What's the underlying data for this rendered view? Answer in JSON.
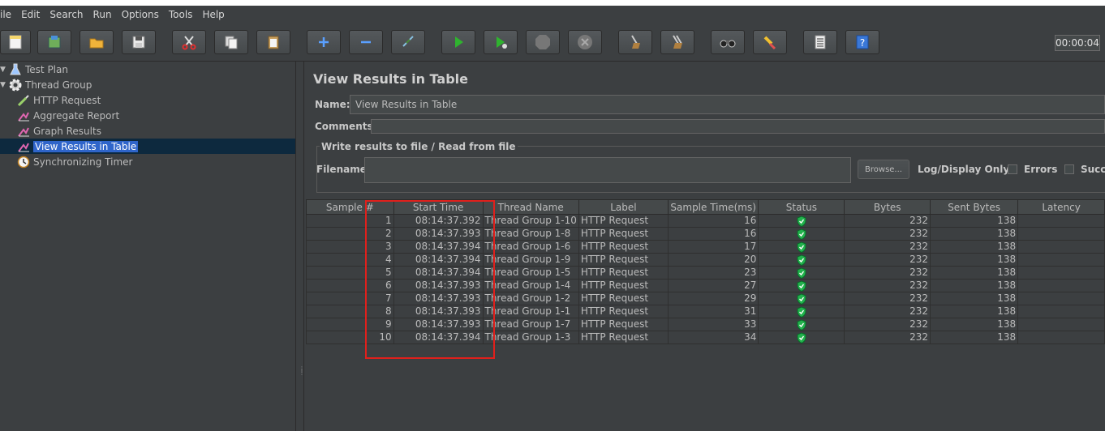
{
  "menu": [
    "ile",
    "Edit",
    "Search",
    "Run",
    "Options",
    "Tools",
    "Help"
  ],
  "toolbar": {
    "buttons": [
      "new-icon",
      "templates-icon",
      "open-icon",
      "save-icon",
      "cut-icon",
      "copy-icon",
      "paste-icon",
      "expand-icon",
      "collapse-icon",
      "toggle-icon",
      "start-icon",
      "start-no-pauses-icon",
      "stop-icon",
      "shutdown-icon",
      "clear-icon",
      "clear-all-icon",
      "search-icon",
      "reset-search-icon",
      "function-helper-icon",
      "help-icon"
    ],
    "timer": "00:00:04"
  },
  "tree": {
    "items": [
      {
        "label": "Test Plan",
        "icon": "test-plan-icon"
      },
      {
        "label": "Thread Group",
        "icon": "gear-icon"
      },
      {
        "label": "HTTP Request",
        "icon": "pipette-icon"
      },
      {
        "label": "Aggregate Report",
        "icon": "chart-icon"
      },
      {
        "label": "Graph Results",
        "icon": "chart-icon"
      },
      {
        "label": "View Results in Table",
        "icon": "chart-icon",
        "selected": true
      },
      {
        "label": "Synchronizing Timer",
        "icon": "timer-icon"
      }
    ]
  },
  "panel": {
    "title": "View Results in Table",
    "name_label": "Name:",
    "name_value": "View Results in Table",
    "comments_label": "Comments:",
    "group_title": "Write results to file / Read from file",
    "filename_label": "Filename",
    "browse_label": "Browse...",
    "log_display_label": "Log/Display Only:",
    "errors_label": "Errors",
    "success_label": "Succe"
  },
  "table": {
    "columns": [
      "Sample #",
      "Start Time",
      "Thread Name",
      "Label",
      "Sample Time(ms)",
      "Status",
      "Bytes",
      "Sent Bytes",
      "Latency"
    ],
    "rows": [
      {
        "sample": "1",
        "start": "08:14:37.392",
        "thread": "Thread Group 1-10",
        "label": "HTTP Request",
        "time": "16",
        "bytes": "232",
        "sent": "138"
      },
      {
        "sample": "2",
        "start": "08:14:37.393",
        "thread": "Thread Group 1-8",
        "label": "HTTP Request",
        "time": "16",
        "bytes": "232",
        "sent": "138"
      },
      {
        "sample": "3",
        "start": "08:14:37.394",
        "thread": "Thread Group 1-6",
        "label": "HTTP Request",
        "time": "17",
        "bytes": "232",
        "sent": "138"
      },
      {
        "sample": "4",
        "start": "08:14:37.394",
        "thread": "Thread Group 1-9",
        "label": "HTTP Request",
        "time": "20",
        "bytes": "232",
        "sent": "138"
      },
      {
        "sample": "5",
        "start": "08:14:37.394",
        "thread": "Thread Group 1-5",
        "label": "HTTP Request",
        "time": "23",
        "bytes": "232",
        "sent": "138"
      },
      {
        "sample": "6",
        "start": "08:14:37.393",
        "thread": "Thread Group 1-4",
        "label": "HTTP Request",
        "time": "27",
        "bytes": "232",
        "sent": "138"
      },
      {
        "sample": "7",
        "start": "08:14:37.393",
        "thread": "Thread Group 1-2",
        "label": "HTTP Request",
        "time": "29",
        "bytes": "232",
        "sent": "138"
      },
      {
        "sample": "8",
        "start": "08:14:37.393",
        "thread": "Thread Group 1-1",
        "label": "HTTP Request",
        "time": "31",
        "bytes": "232",
        "sent": "138"
      },
      {
        "sample": "9",
        "start": "08:14:37.393",
        "thread": "Thread Group 1-7",
        "label": "HTTP Request",
        "time": "33",
        "bytes": "232",
        "sent": "138"
      },
      {
        "sample": "10",
        "start": "08:14:37.394",
        "thread": "Thread Group 1-3",
        "label": "HTTP Request",
        "time": "34",
        "bytes": "232",
        "sent": "138"
      }
    ]
  },
  "colors": {
    "background": "#3c3f41",
    "selection": "#2f65ca",
    "annotation": "#e0201c",
    "status_ok": "#22b14c"
  }
}
